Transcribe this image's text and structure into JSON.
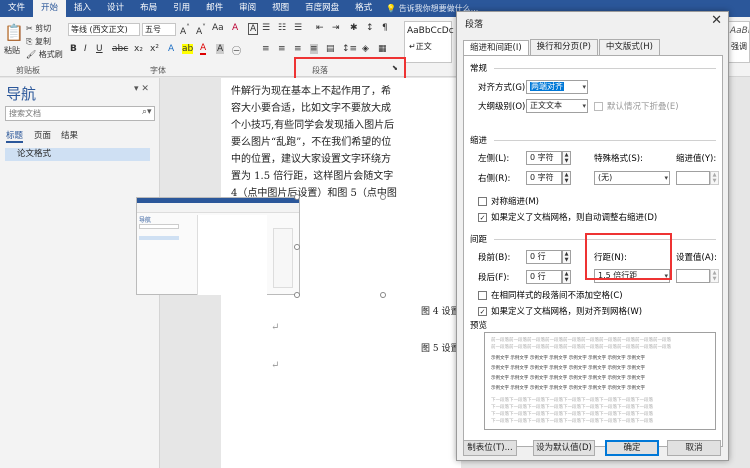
{
  "ribbon": {
    "tabs": [
      "文件",
      "开始",
      "插入",
      "设计",
      "布局",
      "引用",
      "邮件",
      "审阅",
      "视图",
      "百度网盘",
      "格式"
    ],
    "active_tab": "开始",
    "tell_me": "告诉我你想要做什么...",
    "clipboard": {
      "paste": "粘贴",
      "cut": "剪切",
      "copy": "复制",
      "format_painter": "格式刷",
      "label": "剪贴板"
    },
    "font": {
      "name": "等线 (西文正文)",
      "size": "五号",
      "label": "字体"
    },
    "paragraph_label": "段落",
    "styles": [
      "AaBbCcDc",
      "↵正文"
    ],
    "styles_right": [
      "AaBbCc",
      "强调"
    ]
  },
  "nav": {
    "title": "导航",
    "search_placeholder": "搜索文档",
    "tabs": [
      "标题",
      "页面",
      "结果"
    ],
    "items": [
      "论文格式"
    ]
  },
  "document": {
    "lines": [
      "件解行为现在基本上不起作用了，希",
      "容大小要合适，比如文字不要放大成",
      "个小技巧,有些同学会发现插入图片后",
      "要么图片“乱跑”，不在我们希望的位",
      "中的位置，建议大家设置文字环绕方",
      "置为 1.5 倍行距，这样图片会随文字",
      "4（点中图片后设置）和图 5（点中图"
    ],
    "caption4": "图 4  设置",
    "caption5": "图 5  设置",
    "mini_nav": "导航"
  },
  "dialog": {
    "title": "段落",
    "close": "✕",
    "tabs": [
      "缩进和间距(I)",
      "换行和分页(P)",
      "中文版式(H)"
    ],
    "general": {
      "section": "常规",
      "align_label": "对齐方式(G):",
      "align_value": "两端对齐",
      "outline_label": "大纲级别(O):",
      "outline_value": "正文文本",
      "collapse_label": "默认情况下折叠(E)"
    },
    "indent": {
      "section": "缩进",
      "left_label": "左侧(L):",
      "left_value": "0 字符",
      "right_label": "右侧(R):",
      "right_value": "0 字符",
      "special_label": "特殊格式(S):",
      "special_value": "(无)",
      "by_label": "缩进值(Y):",
      "mirror_label": "对称缩进(M)",
      "grid_label": "如果定义了文档网格，则自动调整右缩进(D)"
    },
    "spacing": {
      "section": "间距",
      "before_label": "段前(B):",
      "before_value": "0 行",
      "after_label": "段后(F):",
      "after_value": "0 行",
      "line_label": "行距(N):",
      "line_value": "1.5 倍行距",
      "at_label": "设置值(A):",
      "no_space_label": "在相同样式的段落间不添加空格(C)",
      "snap_label": "如果定义了文档网格，则对齐到网格(W)"
    },
    "preview": {
      "section": "预览",
      "prev_text": "前一段落前一段落前一段落前一段落前一段落前一段落前一段落前一段落前一段落前一段落",
      "sample_text": "示例文字 示例文字 示例文字 示例文字 示例文字 示例文字 示例文字 示例文字",
      "next_text": "下一段落下一段落下一段落下一段落下一段落下一段落下一段落下一段落下一段落"
    },
    "buttons": {
      "tabs": "制表位(T)...",
      "default": "设为默认值(D)",
      "ok": "确定",
      "cancel": "取消"
    }
  },
  "colors": {
    "ribbon_blue": "#2b579a",
    "highlight_red": "#e33333",
    "selection_blue": "#0078d7"
  }
}
